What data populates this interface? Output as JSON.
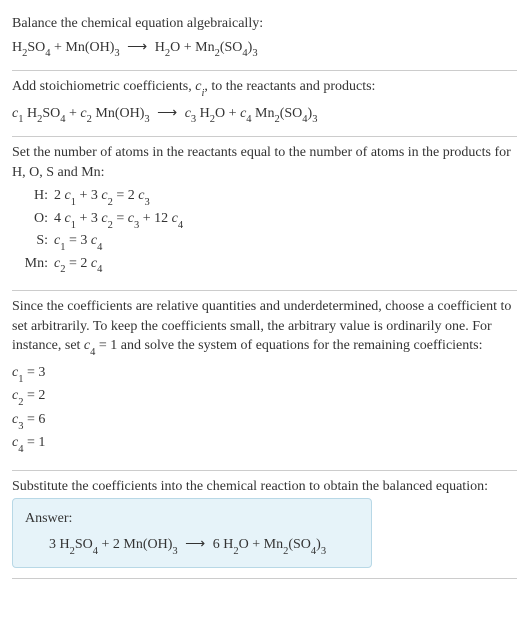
{
  "intro": {
    "title": "Balance the chemical equation algebraically:",
    "equation_html": "H<span class='sub'>2</span>SO<span class='sub'>4</span> + Mn(OH)<span class='sub'>3</span> <span class='arrow'>⟶</span> H<span class='sub'>2</span>O + Mn<span class='sub'>2</span>(SO<span class='sub'>4</span>)<span class='sub'>3</span>"
  },
  "step_coeffs": {
    "text_html": "Add stoichiometric coefficients, <span class='italic'>c<span class='sub'>i</span></span>, to the reactants and products:",
    "equation_html": "<span class='italic'>c</span><span class='sub'>1</span> H<span class='sub'>2</span>SO<span class='sub'>4</span> + <span class='italic'>c</span><span class='sub'>2</span> Mn(OH)<span class='sub'>3</span> <span class='arrow'>⟶</span> <span class='italic'>c</span><span class='sub'>3</span> H<span class='sub'>2</span>O + <span class='italic'>c</span><span class='sub'>4</span> Mn<span class='sub'>2</span>(SO<span class='sub'>4</span>)<span class='sub'>3</span>"
  },
  "atom_balance": {
    "intro": "Set the number of atoms in the reactants equal to the number of atoms in the products for H, O, S and Mn:",
    "rows": [
      {
        "label": "H:",
        "eq_html": "2 <span class='italic'>c</span><span class='sub'>1</span> + 3 <span class='italic'>c</span><span class='sub'>2</span> = 2 <span class='italic'>c</span><span class='sub'>3</span>"
      },
      {
        "label": "O:",
        "eq_html": "4 <span class='italic'>c</span><span class='sub'>1</span> + 3 <span class='italic'>c</span><span class='sub'>2</span> = <span class='italic'>c</span><span class='sub'>3</span> + 12 <span class='italic'>c</span><span class='sub'>4</span>"
      },
      {
        "label": "S:",
        "eq_html": "<span class='italic'>c</span><span class='sub'>1</span> = 3 <span class='italic'>c</span><span class='sub'>4</span>"
      },
      {
        "label": "Mn:",
        "eq_html": "<span class='italic'>c</span><span class='sub'>2</span> = 2 <span class='italic'>c</span><span class='sub'>4</span>"
      }
    ]
  },
  "solve": {
    "intro_html": "Since the coefficients are relative quantities and underdetermined, choose a coefficient to set arbitrarily. To keep the coefficients small, the arbitrary value is ordinarily one. For instance, set <span class='italic'>c</span><span class='sub'>4</span> = 1 and solve the system of equations for the remaining coefficients:",
    "coeffs": [
      {
        "html": "<span class='italic'>c</span><span class='sub'>1</span> = 3"
      },
      {
        "html": "<span class='italic'>c</span><span class='sub'>2</span> = 2"
      },
      {
        "html": "<span class='italic'>c</span><span class='sub'>3</span> = 6"
      },
      {
        "html": "<span class='italic'>c</span><span class='sub'>4</span> = 1"
      }
    ]
  },
  "substitute": {
    "text": "Substitute the coefficients into the chemical reaction to obtain the balanced equation:"
  },
  "answer": {
    "label": "Answer:",
    "equation_html": "3 H<span class='sub'>2</span>SO<span class='sub'>4</span> + 2 Mn(OH)<span class='sub'>3</span> <span class='arrow'>⟶</span> 6 H<span class='sub'>2</span>O + Mn<span class='sub'>2</span>(SO<span class='sub'>4</span>)<span class='sub'>3</span>"
  }
}
